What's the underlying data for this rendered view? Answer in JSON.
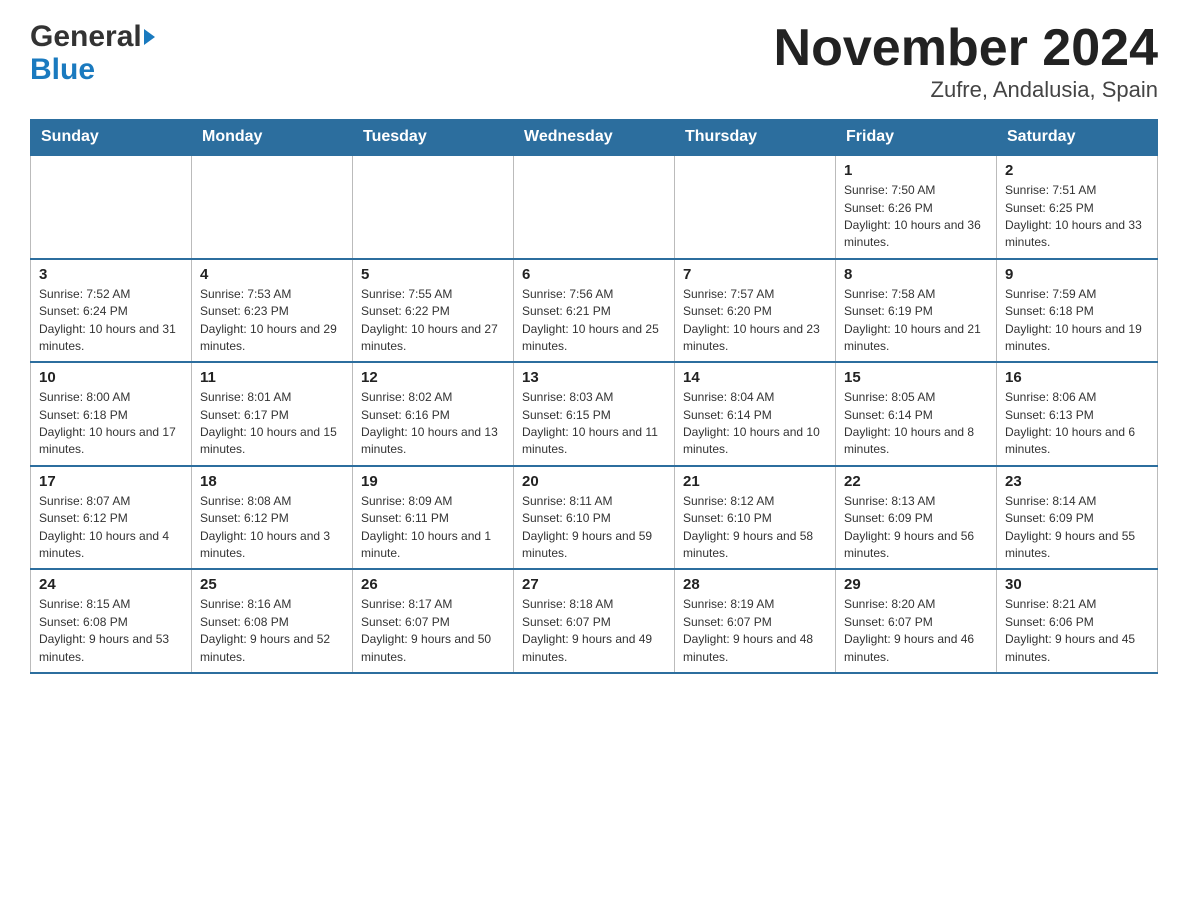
{
  "header": {
    "logo_general": "General",
    "logo_blue": "Blue",
    "title": "November 2024",
    "subtitle": "Zufre, Andalusia, Spain"
  },
  "weekdays": [
    "Sunday",
    "Monday",
    "Tuesday",
    "Wednesday",
    "Thursday",
    "Friday",
    "Saturday"
  ],
  "weeks": [
    [
      {
        "day": "",
        "info": ""
      },
      {
        "day": "",
        "info": ""
      },
      {
        "day": "",
        "info": ""
      },
      {
        "day": "",
        "info": ""
      },
      {
        "day": "",
        "info": ""
      },
      {
        "day": "1",
        "info": "Sunrise: 7:50 AM\nSunset: 6:26 PM\nDaylight: 10 hours and 36 minutes."
      },
      {
        "day": "2",
        "info": "Sunrise: 7:51 AM\nSunset: 6:25 PM\nDaylight: 10 hours and 33 minutes."
      }
    ],
    [
      {
        "day": "3",
        "info": "Sunrise: 7:52 AM\nSunset: 6:24 PM\nDaylight: 10 hours and 31 minutes."
      },
      {
        "day": "4",
        "info": "Sunrise: 7:53 AM\nSunset: 6:23 PM\nDaylight: 10 hours and 29 minutes."
      },
      {
        "day": "5",
        "info": "Sunrise: 7:55 AM\nSunset: 6:22 PM\nDaylight: 10 hours and 27 minutes."
      },
      {
        "day": "6",
        "info": "Sunrise: 7:56 AM\nSunset: 6:21 PM\nDaylight: 10 hours and 25 minutes."
      },
      {
        "day": "7",
        "info": "Sunrise: 7:57 AM\nSunset: 6:20 PM\nDaylight: 10 hours and 23 minutes."
      },
      {
        "day": "8",
        "info": "Sunrise: 7:58 AM\nSunset: 6:19 PM\nDaylight: 10 hours and 21 minutes."
      },
      {
        "day": "9",
        "info": "Sunrise: 7:59 AM\nSunset: 6:18 PM\nDaylight: 10 hours and 19 minutes."
      }
    ],
    [
      {
        "day": "10",
        "info": "Sunrise: 8:00 AM\nSunset: 6:18 PM\nDaylight: 10 hours and 17 minutes."
      },
      {
        "day": "11",
        "info": "Sunrise: 8:01 AM\nSunset: 6:17 PM\nDaylight: 10 hours and 15 minutes."
      },
      {
        "day": "12",
        "info": "Sunrise: 8:02 AM\nSunset: 6:16 PM\nDaylight: 10 hours and 13 minutes."
      },
      {
        "day": "13",
        "info": "Sunrise: 8:03 AM\nSunset: 6:15 PM\nDaylight: 10 hours and 11 minutes."
      },
      {
        "day": "14",
        "info": "Sunrise: 8:04 AM\nSunset: 6:14 PM\nDaylight: 10 hours and 10 minutes."
      },
      {
        "day": "15",
        "info": "Sunrise: 8:05 AM\nSunset: 6:14 PM\nDaylight: 10 hours and 8 minutes."
      },
      {
        "day": "16",
        "info": "Sunrise: 8:06 AM\nSunset: 6:13 PM\nDaylight: 10 hours and 6 minutes."
      }
    ],
    [
      {
        "day": "17",
        "info": "Sunrise: 8:07 AM\nSunset: 6:12 PM\nDaylight: 10 hours and 4 minutes."
      },
      {
        "day": "18",
        "info": "Sunrise: 8:08 AM\nSunset: 6:12 PM\nDaylight: 10 hours and 3 minutes."
      },
      {
        "day": "19",
        "info": "Sunrise: 8:09 AM\nSunset: 6:11 PM\nDaylight: 10 hours and 1 minute."
      },
      {
        "day": "20",
        "info": "Sunrise: 8:11 AM\nSunset: 6:10 PM\nDaylight: 9 hours and 59 minutes."
      },
      {
        "day": "21",
        "info": "Sunrise: 8:12 AM\nSunset: 6:10 PM\nDaylight: 9 hours and 58 minutes."
      },
      {
        "day": "22",
        "info": "Sunrise: 8:13 AM\nSunset: 6:09 PM\nDaylight: 9 hours and 56 minutes."
      },
      {
        "day": "23",
        "info": "Sunrise: 8:14 AM\nSunset: 6:09 PM\nDaylight: 9 hours and 55 minutes."
      }
    ],
    [
      {
        "day": "24",
        "info": "Sunrise: 8:15 AM\nSunset: 6:08 PM\nDaylight: 9 hours and 53 minutes."
      },
      {
        "day": "25",
        "info": "Sunrise: 8:16 AM\nSunset: 6:08 PM\nDaylight: 9 hours and 52 minutes."
      },
      {
        "day": "26",
        "info": "Sunrise: 8:17 AM\nSunset: 6:07 PM\nDaylight: 9 hours and 50 minutes."
      },
      {
        "day": "27",
        "info": "Sunrise: 8:18 AM\nSunset: 6:07 PM\nDaylight: 9 hours and 49 minutes."
      },
      {
        "day": "28",
        "info": "Sunrise: 8:19 AM\nSunset: 6:07 PM\nDaylight: 9 hours and 48 minutes."
      },
      {
        "day": "29",
        "info": "Sunrise: 8:20 AM\nSunset: 6:07 PM\nDaylight: 9 hours and 46 minutes."
      },
      {
        "day": "30",
        "info": "Sunrise: 8:21 AM\nSunset: 6:06 PM\nDaylight: 9 hours and 45 minutes."
      }
    ]
  ]
}
